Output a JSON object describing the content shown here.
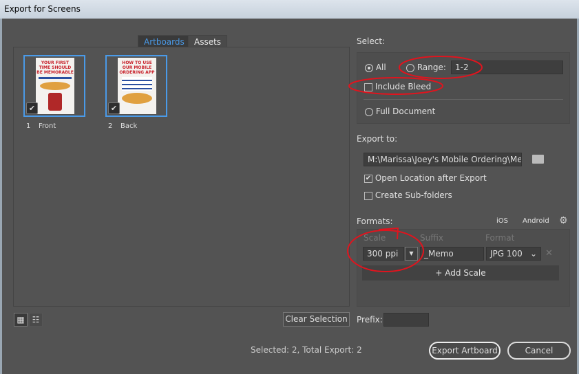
{
  "window": {
    "title": "Export for Screens"
  },
  "tabs": [
    {
      "label": "Artboards",
      "active": true
    },
    {
      "label": "Assets",
      "active": false
    }
  ],
  "artboards": [
    {
      "number": "1",
      "name": "Front",
      "checked": true,
      "thumb_title": "YOUR FIRST TIME SHOULD BE MEMORABLE"
    },
    {
      "number": "2",
      "name": "Back",
      "checked": true,
      "thumb_title": "HOW TO USE OUR MOBILE ORDERING APP"
    }
  ],
  "clear_selection": "Clear Selection",
  "status": "Selected: 2, Total Export: 2",
  "select": {
    "heading": "Select:",
    "all": "All",
    "range": "Range:",
    "range_value": "1-2",
    "include_bleed": "Include Bleed",
    "full_document": "Full Document"
  },
  "export_to": {
    "heading": "Export to:",
    "path": "M:\\Marissa\\Joey's Mobile Ordering\\Memo",
    "open_location": "Open Location after Export",
    "create_subfolders": "Create Sub-folders"
  },
  "formats": {
    "heading": "Formats:",
    "ios": "iOS",
    "android": "Android",
    "col_scale": "Scale",
    "col_suffix": "Suffix",
    "col_format": "Format",
    "scale": "300 ppi",
    "suffix": "_Memo",
    "format": "JPG 100",
    "add_scale": "Add Scale"
  },
  "prefix": {
    "label": "Prefix:",
    "value": ""
  },
  "buttons": {
    "export": "Export Artboard",
    "cancel": "Cancel"
  },
  "colors": {
    "accent": "#4a9ae8",
    "annotation": "#e0141e"
  }
}
